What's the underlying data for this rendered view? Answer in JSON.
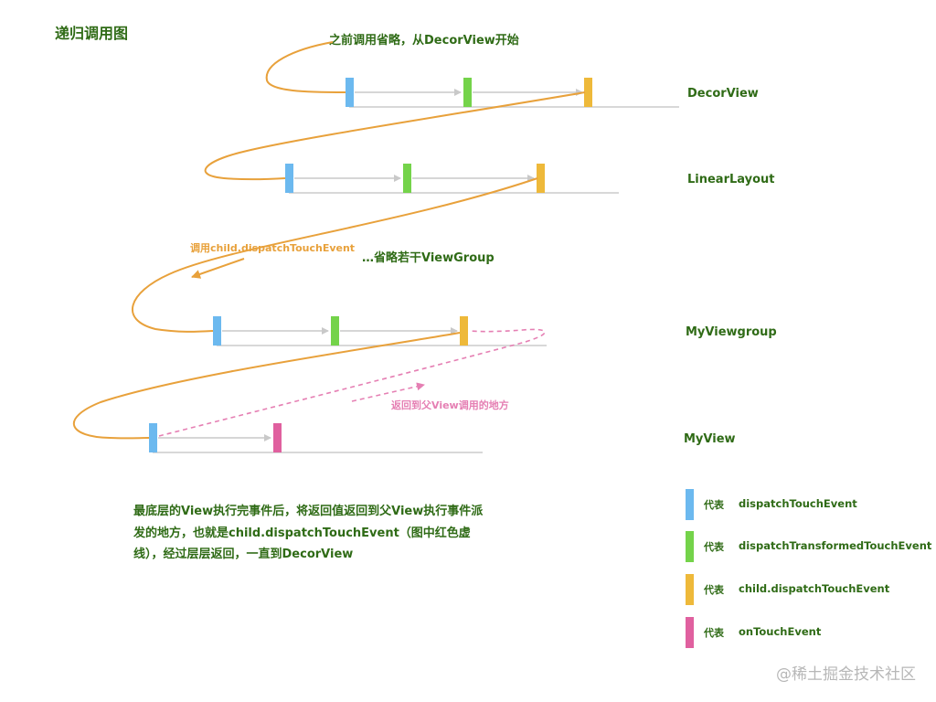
{
  "title": "递归调用图",
  "annotations": {
    "top_note": "之前调用省略，从DecorView开始",
    "call_child": "调用child.dispatchTouchEvent",
    "ellipsis": "…省略若干ViewGroup",
    "return_note": "返回到父View调用的地方"
  },
  "layers": [
    {
      "name": "DecorView"
    },
    {
      "name": "LinearLayout"
    },
    {
      "name": "MyViewgroup"
    },
    {
      "name": "MyView"
    }
  ],
  "note_text": "最底层的View执行完事件后，将返回值返回到父View执行事件派发的地方，也就是child.dispatchTouchEvent（图中红色虚线），经过层层返回，一直到DecorView",
  "legend": [
    {
      "prefix": "代表",
      "label": "dispatchTouchEvent",
      "color": "#6cb9ef"
    },
    {
      "prefix": "代表",
      "label": "dispatchTransformedTouchEvent",
      "color": "#74d34a"
    },
    {
      "prefix": "代表",
      "label": "child.dispatchTouchEvent",
      "color": "#eeb93a"
    },
    {
      "prefix": "代表",
      "label": "onTouchEvent",
      "color": "#e0609f"
    }
  ],
  "colors": {
    "dispatch": "#6cb9ef",
    "transformed": "#74d34a",
    "child": "#eeb93a",
    "ontouch": "#e0609f",
    "orange_line": "#e8a13b",
    "pink_dashed": "#e57fb3",
    "text_green": "#2f6b16",
    "gray_line": "#cccccc"
  },
  "watermark": "@稀土掘金技术社区"
}
